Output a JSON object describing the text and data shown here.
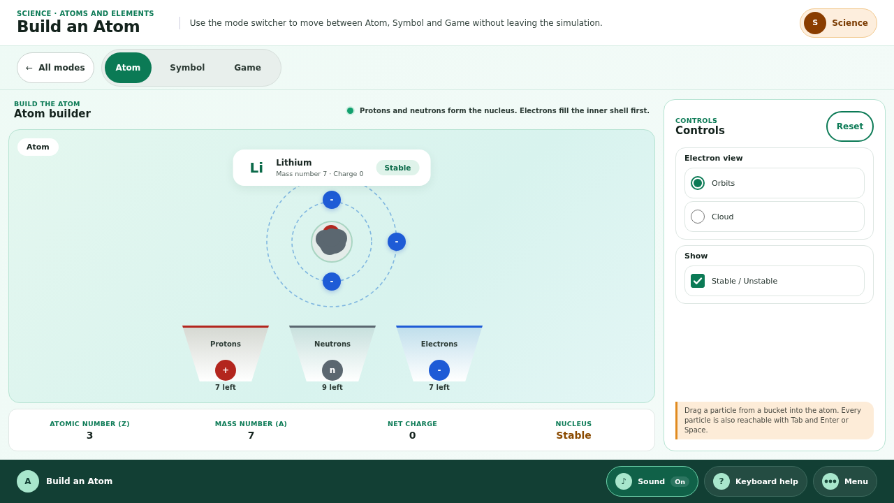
{
  "header": {
    "eyebrow": "SCIENCE · ATOMS AND ELEMENTS",
    "title": "Build an Atom",
    "description": "Use the mode switcher to move between Atom, Symbol and Game without leaving the simulation.",
    "badge": {
      "initial": "S",
      "label": "Science"
    }
  },
  "modes": {
    "back": {
      "arrow": "←",
      "label": "All modes"
    },
    "tabs": [
      {
        "label": "Atom",
        "selected": true
      },
      {
        "label": "Symbol",
        "selected": false
      },
      {
        "label": "Game",
        "selected": false
      }
    ]
  },
  "builder": {
    "eyebrow": "BUILD THE ATOM",
    "title": "Atom builder",
    "hint": "Protons and neutrons form the nucleus. Electrons fill the inner shell first.",
    "canvas": {
      "tag": "Atom",
      "element": {
        "symbol": "Li",
        "name": "Lithium",
        "detail": "Mass number 7 · Charge 0",
        "status": "Stable"
      },
      "electrons": [
        {
          "symbol": "-"
        },
        {
          "symbol": "-"
        },
        {
          "symbol": "-"
        }
      ],
      "buckets": [
        {
          "label": "Protons",
          "particle": "+",
          "remaining": "7 left",
          "color": "#b3261e"
        },
        {
          "label": "Neutrons",
          "particle": "n",
          "remaining": "9 left",
          "color": "#5b6770"
        },
        {
          "label": "Electrons",
          "particle": "-",
          "remaining": "7 left",
          "color": "#1e5bd6"
        }
      ]
    },
    "stats": [
      {
        "label": "ATOMIC NUMBER (Z)",
        "value": "3",
        "kind": "number"
      },
      {
        "label": "MASS NUMBER (A)",
        "value": "7",
        "kind": "number"
      },
      {
        "label": "NET CHARGE",
        "value": "0",
        "kind": "number"
      },
      {
        "label": "NUCLEUS",
        "value": "Stable",
        "kind": "status"
      }
    ]
  },
  "controls": {
    "eyebrow": "CONTROLS",
    "title": "Controls",
    "reset": "Reset",
    "groups": [
      {
        "title": "Electron view",
        "options": [
          {
            "kind": "radio",
            "label": "Orbits",
            "selected": true
          },
          {
            "kind": "radio",
            "label": "Cloud",
            "selected": false
          }
        ]
      },
      {
        "title": "Show",
        "options": [
          {
            "kind": "checkbox",
            "label": "Stable / Unstable",
            "checked": true
          }
        ]
      }
    ],
    "note": "Drag a particle from a bucket into the atom. Every particle is also reachable with Tab and Enter or Space."
  },
  "footer": {
    "app": {
      "initial": "A",
      "title": "Build an Atom"
    },
    "buttons": [
      {
        "kind": "toggle",
        "icon": "♪",
        "label": "Sound",
        "state": "On",
        "on": true
      },
      {
        "kind": "help",
        "icon": "?",
        "label": "Keyboard help"
      },
      {
        "kind": "menu",
        "label": "Menu"
      }
    ]
  }
}
